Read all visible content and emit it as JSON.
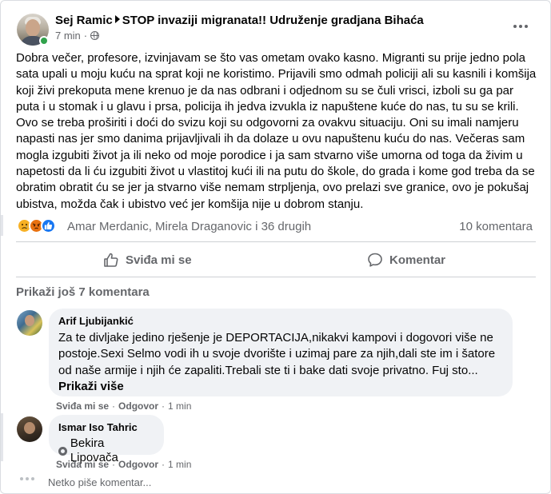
{
  "post": {
    "author": "Sej Ramic",
    "group": "STOP invaziji migranata!! Udruženje gradjana Bihaća",
    "time": "7 min",
    "separator": "·",
    "privacy_icon": "globe-icon",
    "text": "Dobra večer, profesore, izvinjavam se što vas ometam ovako kasno. Migranti su prije jedno pola sata upali u moju kuću na sprat koji ne koristimo. Prijavili smo odmah policiji ali su kasnili i komšija koji živi prekoputa mene krenuo je da nas odbrani i odjednom su se čuli vrisci, izboli su ga par puta i u stomak i u glavu i prsa, policija ih jedva izvukla iz napuštene kuće do nas, tu su se krili. Ovo se treba proširiti i doći do svizu koji su odgovorni za ovakvu situaciju. Oni su imali namjeru napasti nas jer smo danima prijavljivali ih da dolaze u ovu napuštenu kuću do nas. Večeras sam mogla izgubiti život ja ili neko od moje porodice i ja sam stvarno više umorna od toga da živim u napetosti da li ću izgubiti život u vlastitoj kući ili na putu do škole, do grada i kome god treba da se obratim obratit ću se jer ja stvarno više nemam strpljenja, ovo prelazi sve granice, ovo je pokušaj ubistva, možda čak i ubistvo već jer komšija nije u dobrom stanju.",
    "reactions": {
      "icons": [
        "sad-reaction-icon",
        "angry-reaction-icon",
        "like-reaction-icon"
      ],
      "names": "Amar Merdanic, Mirela Draganovic i 36 drugih",
      "comment_count": "10 komentara"
    },
    "actions": {
      "like_label": "Sviđa mi se",
      "comment_label": "Komentar"
    }
  },
  "comments": {
    "show_more": "Prikaži još 7 komentara",
    "items": [
      {
        "name": "Arif Ljubijankić",
        "text": "Za te divljake jedino rješenje je DEPORTACIJA,nikakvi kampovi i dogovori više ne postoje.Sexi Selmo vodi ih u svoje dvorište i uzimaj pare za njih,dali ste im i šatore od naše armije i njih će zapaliti.Trebali ste ti i bake dati svoje privatno. Fuj sto...",
        "show_more": "Prikaži više",
        "like": "Sviđa mi se",
        "reply": "Odgovor",
        "time": "1 min"
      },
      {
        "name": "Ismar Iso Tahric",
        "mention": "Bekira Lipovača",
        "like": "Sviđa mi se",
        "reply": "Odgovor",
        "time": "1 min"
      }
    ],
    "dot": "·",
    "typing": "Netko piše komentar..."
  },
  "colors": {
    "text": "#050505",
    "secondary": "#65676b",
    "bubble": "#f0f2f5",
    "online": "#31a24c",
    "like_blue": "#1877f2"
  }
}
